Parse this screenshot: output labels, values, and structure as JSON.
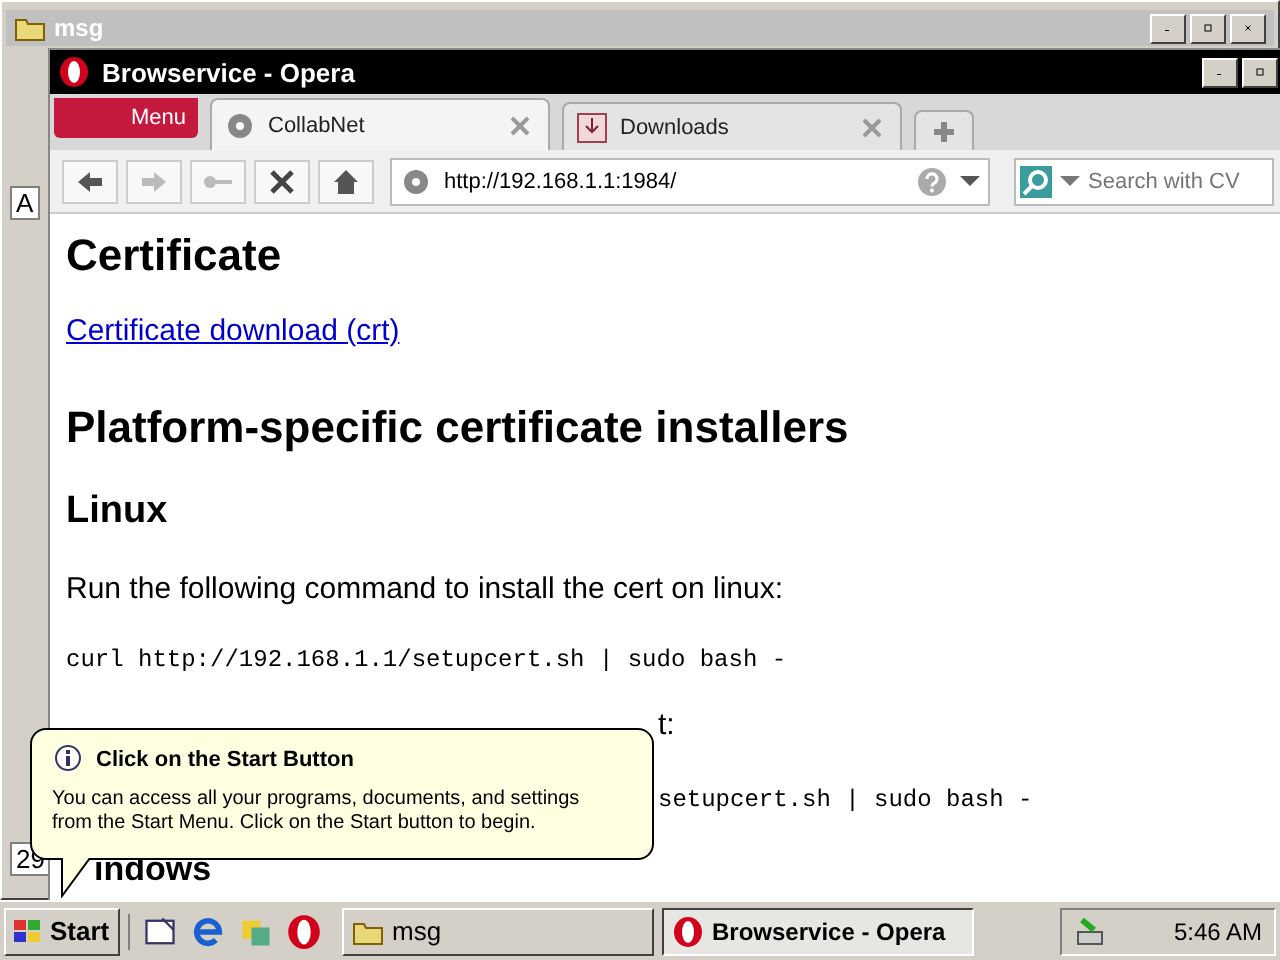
{
  "background_window": {
    "title": "msg",
    "side_texts": [
      "A",
      "29"
    ]
  },
  "browser": {
    "title": "Browservice - Opera",
    "menu_button": "Menu",
    "tabs": [
      {
        "label": "CollabNet",
        "selected": true,
        "kind": "web"
      },
      {
        "label": "Downloads",
        "selected": false,
        "kind": "downloads"
      }
    ],
    "address": "http://192.168.1.1:1984/",
    "search_placeholder": "Search with CV",
    "content": [
      {
        "kind": "h1",
        "text": "Certificate"
      },
      {
        "kind": "link",
        "text": "Certificate download (crt)"
      },
      {
        "kind": "h1",
        "text": "Platform-specific certificate installers"
      },
      {
        "kind": "h2",
        "text": "Linux"
      },
      {
        "kind": "p",
        "text": "Run the following command to install the cert on linux:"
      },
      {
        "kind": "code",
        "text": "curl http://192.168.1.1/setupcert.sh | sudo bash -"
      },
      {
        "kind": "p_tail",
        "text": "t:"
      },
      {
        "kind": "code_tail",
        "text": "setupcert.sh | sudo bash -"
      },
      {
        "kind": "h2_tail",
        "text": "indows"
      }
    ]
  },
  "balloon": {
    "title": "Click on the Start Button",
    "text": "You can access all your programs, documents, and settings from the Start Menu. Click on the Start button to begin."
  },
  "taskbar": {
    "start": "Start",
    "tasks": [
      {
        "label": "msg",
        "selected": false,
        "kind": "folder"
      },
      {
        "label": "Browservice - Opera",
        "selected": true,
        "kind": "opera"
      }
    ],
    "clock": "5:46 AM"
  }
}
